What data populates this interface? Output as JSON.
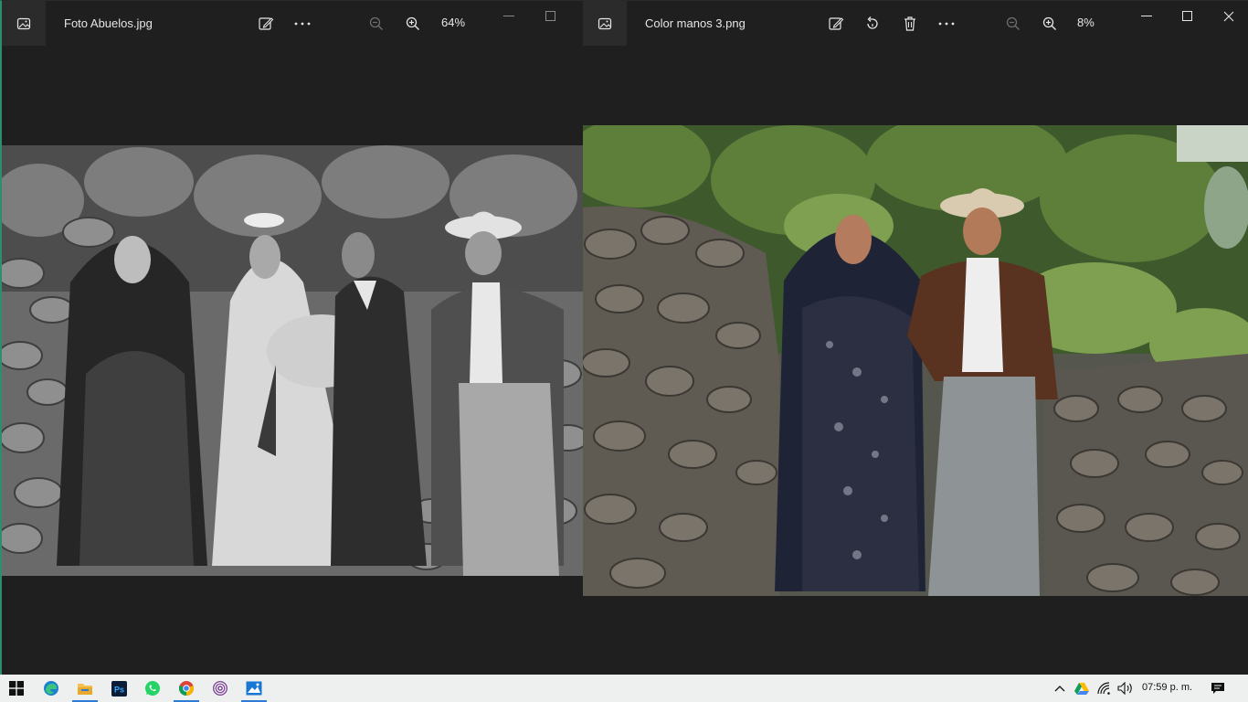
{
  "left_window": {
    "title": "Foto Abuelos.jpg",
    "zoom": "64%",
    "icons": [
      "photos-app-icon",
      "edit-image-icon",
      "more-icon",
      "zoom-out-icon",
      "zoom-in-icon",
      "minimize-icon",
      "maximize-icon"
    ],
    "image": "black-and-white family wedding photograph"
  },
  "right_window": {
    "title": "Color manos 3.png",
    "zoom": "8%",
    "icons": [
      "photos-app-icon",
      "edit-image-icon",
      "rotate-icon",
      "delete-icon",
      "more-icon",
      "zoom-out-icon",
      "zoom-in-icon",
      "minimize-icon",
      "maximize-icon",
      "close-icon"
    ],
    "image": "colorized photograph of a couple in front of a stone wall"
  },
  "taskbar": {
    "apps": [
      "windows-start",
      "edge",
      "file-explorer",
      "photoshop",
      "whatsapp",
      "chrome",
      "tor-browser",
      "photos"
    ],
    "ps_label": "Ps",
    "clock": "07:59 p. m."
  },
  "colors": {
    "window_bg": "#1f1f1f",
    "taskbar_bg": "#eef0f0",
    "accent_border": "#2a8f6a",
    "active_underline": "#2f7bd6"
  }
}
